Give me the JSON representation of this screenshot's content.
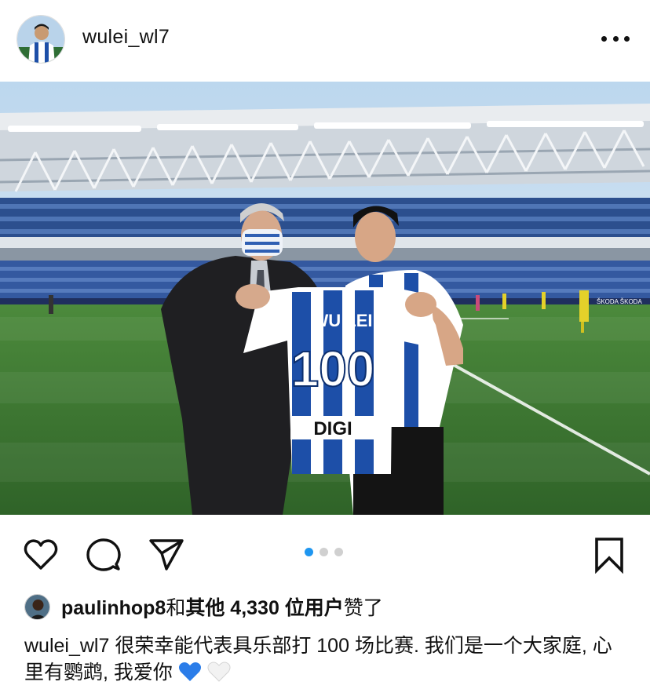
{
  "post": {
    "username": "wulei_wl7",
    "more_icon": "more-horizontal-icon"
  },
  "photo": {
    "jersey_name": "WU LEI",
    "jersey_number": "100",
    "jersey_sponsor": "DIGI",
    "board_text": "ŠKODA ŠKODA"
  },
  "actions": {
    "like_icon": "heart-icon",
    "comment_icon": "comment-icon",
    "share_icon": "send-icon",
    "save_icon": "bookmark-icon",
    "carousel": {
      "count": 3,
      "active_index": 0
    }
  },
  "likes": {
    "user": "paulinhop8",
    "connector": "和",
    "others_text": "其他 4,330 位用户",
    "suffix": "赞了"
  },
  "caption": {
    "username": "wulei_wl7",
    "text": " 很荣幸能代表具乐部打 100 场比赛. 我们是一个大家庭, 心里有鹦鹉, 我爱你",
    "emojis": [
      "blue-heart-icon",
      "white-heart-icon"
    ]
  },
  "colors": {
    "accent_blue": "#1e96f0",
    "espanyol_blue": "#1d4fa8",
    "pitch_green": "#3f7a32"
  }
}
